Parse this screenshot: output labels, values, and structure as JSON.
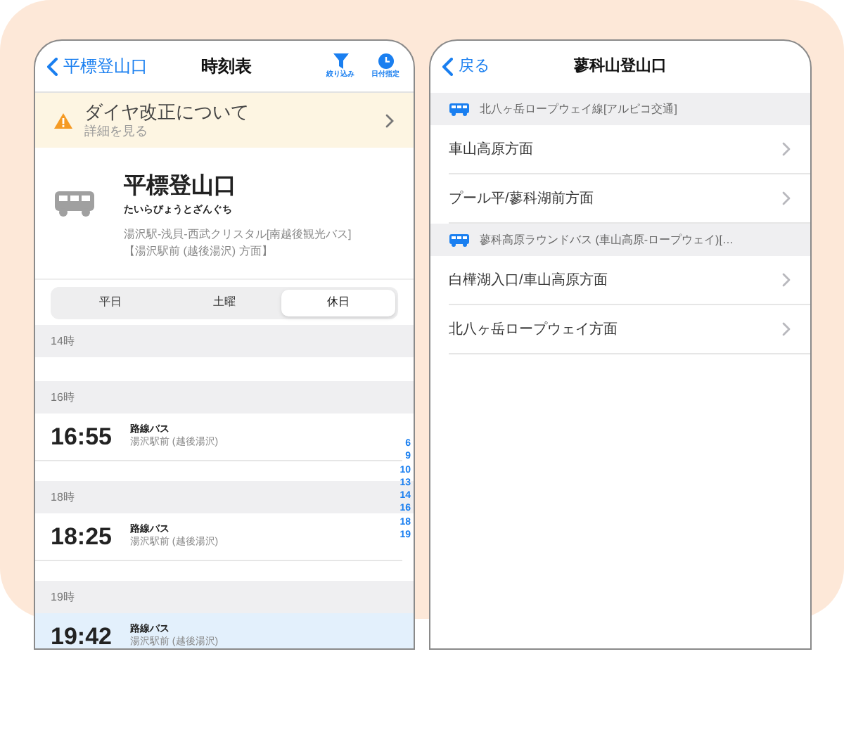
{
  "timetable_screen": {
    "nav": {
      "back": "平標登山口",
      "title": "時刻表",
      "actions": [
        {
          "kind": "filter",
          "label": "絞り込み"
        },
        {
          "kind": "date",
          "label": "日付指定"
        }
      ]
    },
    "notice": {
      "title": "ダイヤ改正について",
      "subtitle": "詳細を見る"
    },
    "stop": {
      "name": "平標登山口",
      "reading": "たいらびょうとざんぐち",
      "line": "湯沢駅-浅貝-西武クリスタル[南越後観光バス]",
      "direction": "【湯沢駅前 (越後湯沢) 方面】"
    },
    "day_tabs": [
      {
        "label": "平日",
        "selected": false
      },
      {
        "label": "土曜",
        "selected": false
      },
      {
        "label": "休日",
        "selected": true
      }
    ],
    "hours": [
      {
        "hour": "14時"
      },
      {
        "hour": "16時",
        "entries": [
          {
            "time": "16:55",
            "type": "路線バス",
            "destination": "湯沢駅前 (越後湯沢)",
            "selected": false
          }
        ]
      },
      {
        "hour": "18時",
        "entries": [
          {
            "time": "18:25",
            "type": "路線バス",
            "destination": "湯沢駅前 (越後湯沢)",
            "selected": false
          }
        ]
      },
      {
        "hour": "19時",
        "entries": [
          {
            "time": "19:42",
            "type": "路線バス",
            "destination": "湯沢駅前 (越後湯沢)",
            "selected": true
          }
        ]
      }
    ],
    "hour_index": [
      "6",
      "9",
      "10",
      "13",
      "14",
      "16",
      "18",
      "19"
    ]
  },
  "route_screen": {
    "nav": {
      "back": "戻る",
      "title": "蓼科山登山口"
    },
    "sections": [
      {
        "line": "北八ヶ岳ロープウェイ線[アルピコ交通]",
        "directions": [
          "車山高原方面",
          "プール平/蓼科湖前方面"
        ]
      },
      {
        "line": "蓼科高原ラウンドバス (車山高原-ロープウェイ)[…",
        "directions": [
          "白樺湖入口/車山高原方面",
          "北八ヶ岳ロープウェイ方面"
        ]
      }
    ]
  }
}
